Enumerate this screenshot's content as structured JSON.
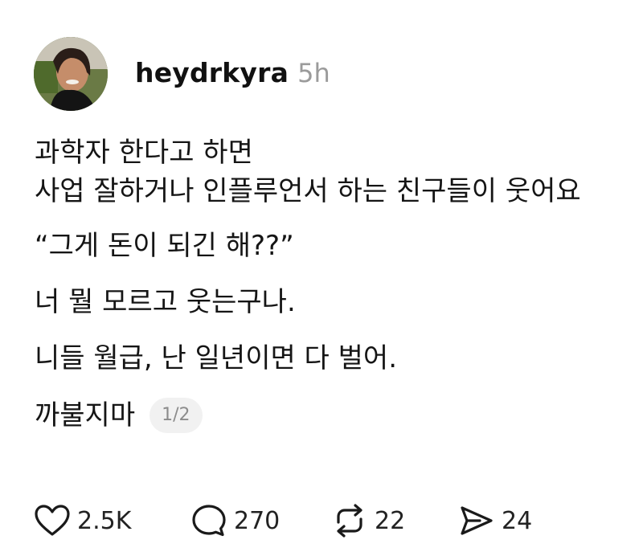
{
  "post": {
    "username": "heydrkyra",
    "time": "5h",
    "lines": [
      "과학자 한다고 하면",
      "사업 잘하거나 인플루언서 하는 친구들이 웃어요",
      "“그게 돈이 되긴 해??”",
      "너 뭘 모르고 웃는구나.",
      "니들 월급, 난 일년이면 다 벌어.",
      "까불지마"
    ],
    "page_indicator": "1/2"
  },
  "actions": {
    "likes": "2.5K",
    "comments": "270",
    "reposts": "22",
    "shares": "24"
  },
  "icons": {
    "like": "heart-icon",
    "comment": "comment-bubble-icon",
    "repost": "repost-icon",
    "share": "send-icon"
  }
}
